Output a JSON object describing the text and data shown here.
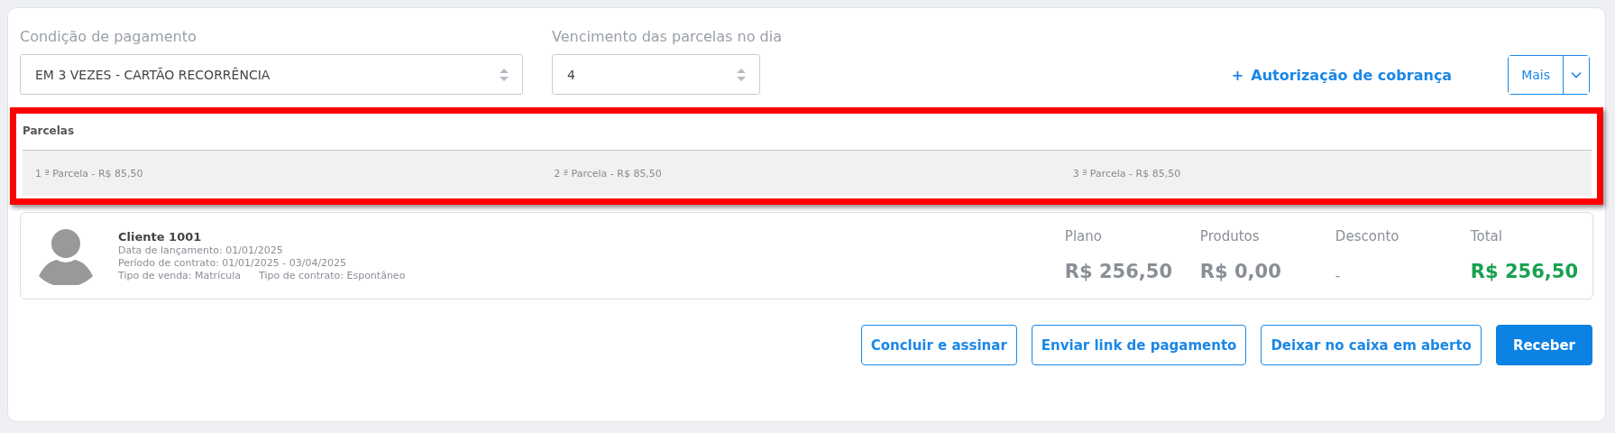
{
  "payment_condition": {
    "label": "Condição de pagamento",
    "value": "EM 3 VEZES - CARTÃO RECORRÊNCIA"
  },
  "due_day": {
    "label": "Vencimento das parcelas no dia",
    "value": "4"
  },
  "authorization_link": {
    "icon": "+",
    "label": "Autorização de cobrança"
  },
  "more_button": {
    "label": "Mais"
  },
  "installments": {
    "title": "Parcelas",
    "items": [
      {
        "label": "1 ª Parcela - R$ 85,50"
      },
      {
        "label": "2 ª Parcela - R$ 85,50"
      },
      {
        "label": "3 ª Parcela - R$ 85,50"
      }
    ]
  },
  "client": {
    "name": "Cliente 1001",
    "release_date": "Data de lançamento: 01/01/2025",
    "contract_period": "Período de contrato: 01/01/2025 - 03/04/2025",
    "sale_type": "Tipo de venda: Matrícula",
    "contract_type": "Tipo de contrato: Espontâneo"
  },
  "summary": [
    {
      "label": "Plano",
      "value": "R$ 256,50",
      "kind": "amount"
    },
    {
      "label": "Produtos",
      "value": "R$ 0,00",
      "kind": "amount"
    },
    {
      "label": "Desconto",
      "value": "-",
      "kind": "empty"
    },
    {
      "label": "Total",
      "value": "R$ 256,50",
      "kind": "total"
    }
  ],
  "actions": [
    {
      "label": "Concluir e assinar",
      "kind": "outline"
    },
    {
      "label": "Enviar link de pagamento",
      "kind": "outline"
    },
    {
      "label": "Deixar no caixa em aberto",
      "kind": "outline"
    },
    {
      "label": "Receber",
      "kind": "primary"
    }
  ]
}
